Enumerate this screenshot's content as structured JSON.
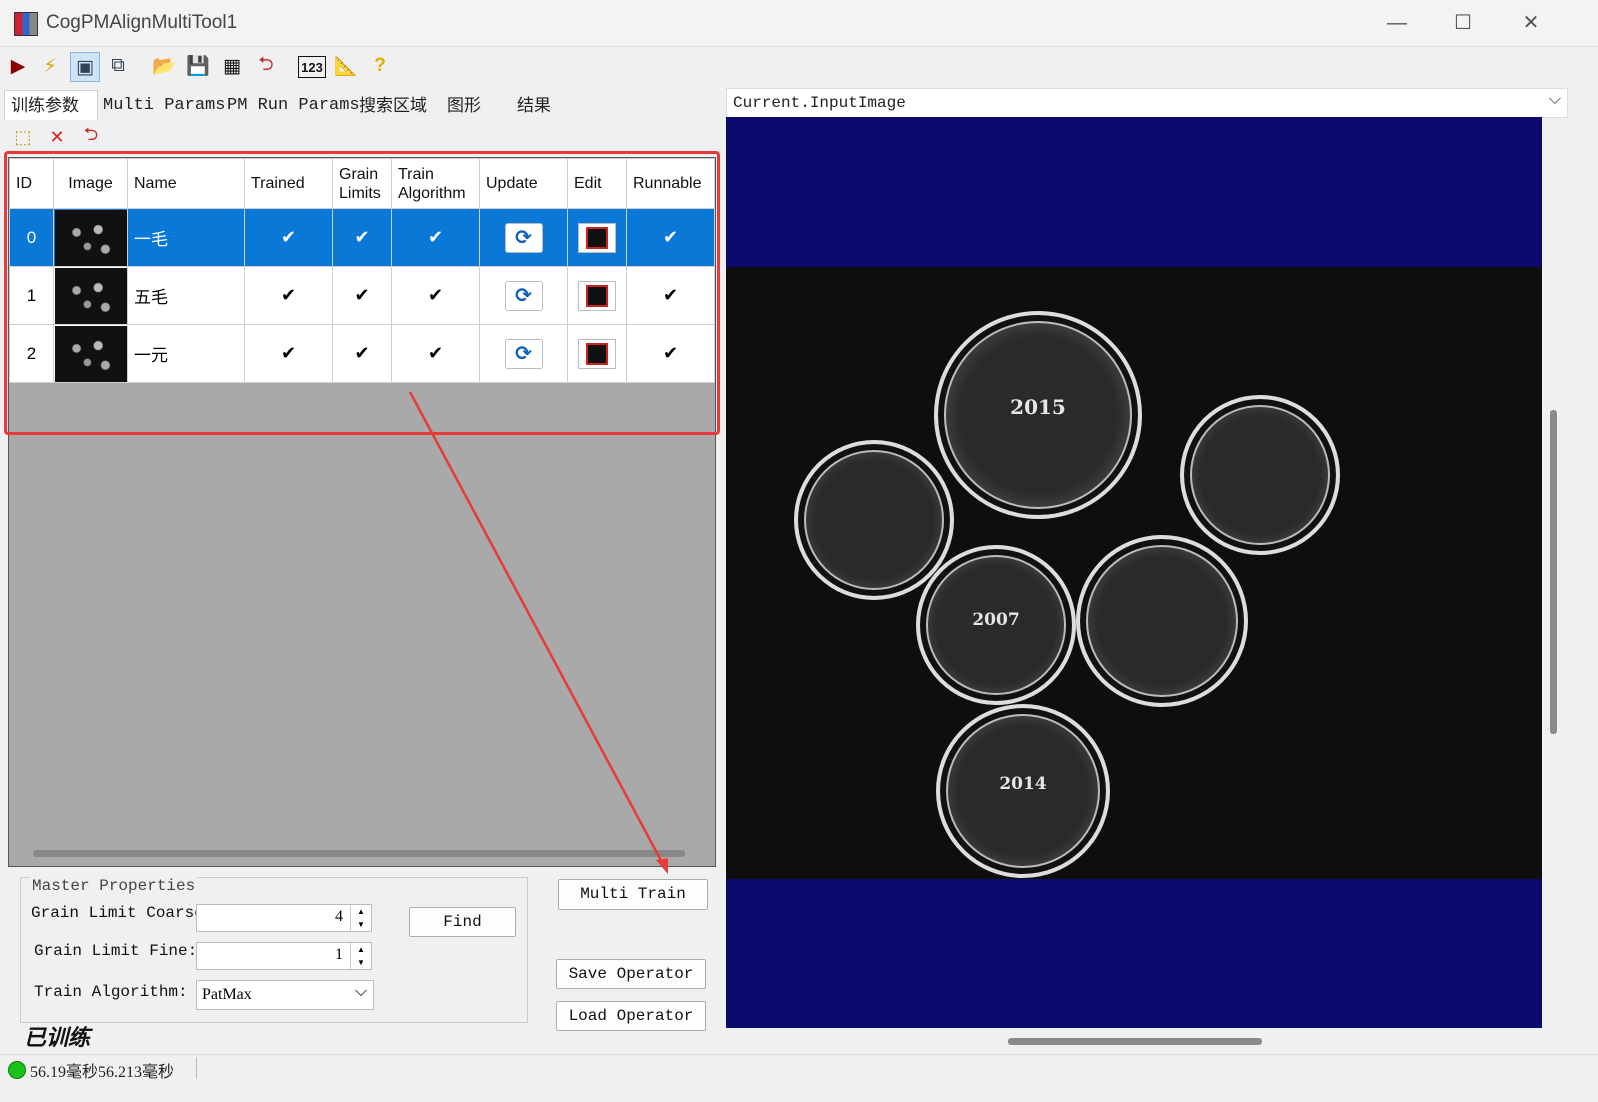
{
  "window": {
    "title": "CogPMAlignMultiTool1",
    "controls": [
      "minimize-icon",
      "maximize-icon",
      "close-icon"
    ]
  },
  "toolbar": {
    "icons": [
      "run-icon",
      "electric-run-icon",
      "show-display-icon",
      "floating-display-icon",
      "open-icon",
      "save-icon",
      "save-as-icon",
      "reset-icon",
      "numeric-icon",
      "ruler-icon",
      "help-icon"
    ]
  },
  "tabs": [
    {
      "label": "训练参数"
    },
    {
      "label": "Multi Params"
    },
    {
      "label": "PM Run Params"
    },
    {
      "label": "搜索区域"
    },
    {
      "label": "图形"
    },
    {
      "label": "结果"
    }
  ],
  "subtoolbar": {
    "icons": [
      "new-icon",
      "delete-icon",
      "import-icon"
    ]
  },
  "grid": {
    "columns": [
      "ID",
      "Image",
      "Name",
      "Trained",
      "Grain Limits",
      "Train Algorithm",
      "Update",
      "Edit",
      "Runnable"
    ],
    "rows": [
      {
        "id": "0",
        "name": "一毛",
        "trained": "✔",
        "grain": "✔",
        "algo": "✔",
        "runnable": "✔"
      },
      {
        "id": "1",
        "name": "五毛",
        "trained": "✔",
        "grain": "✔",
        "algo": "✔",
        "runnable": "✔"
      },
      {
        "id": "2",
        "name": "一元",
        "trained": "✔",
        "grain": "✔",
        "algo": "✔",
        "runnable": "✔"
      }
    ]
  },
  "master": {
    "legend": "Master Properties",
    "coarse_label": "Grain Limit Coarse:",
    "coarse_value": "4",
    "fine_label": "Grain Limit Fine:",
    "fine_value": "1",
    "algo_label": "Train Algorithm:",
    "algo_value": "PatMax",
    "find_label": "Find"
  },
  "buttons": {
    "multi_train": "Multi Train",
    "save_operator": "Save Operator",
    "load_operator": "Load Operator"
  },
  "status": {
    "trained_text": "已训练",
    "time_text": "56.19毫秒56.213毫秒",
    "dot_color": "#19c219"
  },
  "display": {
    "image_selector": "Current.InputImage"
  },
  "image": {
    "coins": [
      {
        "label": "2015"
      },
      {
        "label": "2007"
      },
      {
        "label": "2014"
      }
    ]
  },
  "annotation": {
    "highlight_color": "#e83a3a"
  }
}
